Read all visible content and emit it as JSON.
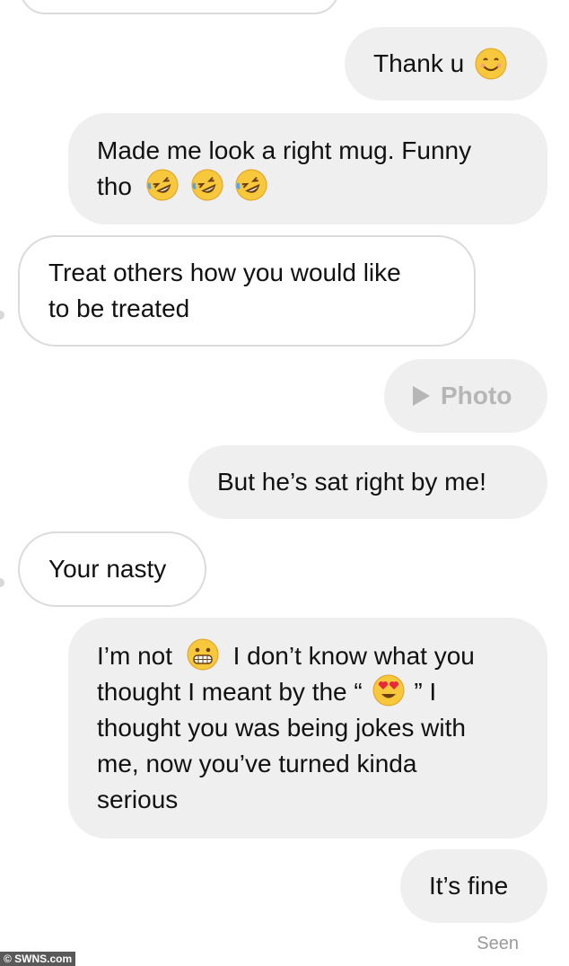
{
  "messages": [
    {
      "direction": "out",
      "text": "Thank u",
      "emoji": [
        "smiling-face"
      ]
    },
    {
      "direction": "out",
      "lines": [
        "Made me look a right mug. Funny",
        "tho"
      ],
      "emoji": [
        "rofl",
        "rofl",
        "rofl"
      ]
    },
    {
      "direction": "in",
      "lines": [
        "Treat others how you would like",
        "to be treated"
      ]
    },
    {
      "direction": "out",
      "type": "photo",
      "text": "Photo"
    },
    {
      "direction": "out",
      "text": "But he’s sat right by me!"
    },
    {
      "direction": "in",
      "text": "Your nasty"
    },
    {
      "direction": "out",
      "lines": [
        "I’m not",
        "I don’t know what you",
        "thought I meant by the “",
        "” I",
        "thought you was being jokes with",
        "me, now you’ve turned kinda",
        "serious"
      ],
      "emoji": [
        "grimacing",
        "heart-eyes"
      ]
    },
    {
      "direction": "out",
      "text": "It’s fine"
    }
  ],
  "status": {
    "seen": "Seen"
  },
  "watermark": "© SWNS.com",
  "colors": {
    "outgoing_bg": "#efefef",
    "incoming_border": "#dbdbdb",
    "emoji_yellow": "#f7c83c"
  }
}
